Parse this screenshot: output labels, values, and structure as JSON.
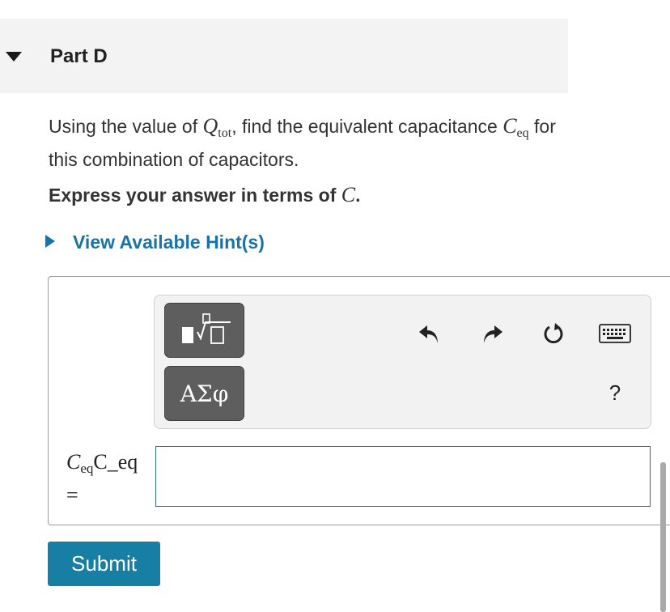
{
  "part": {
    "title": "Part D",
    "expanded": true
  },
  "question": {
    "text_1": "Using the value of",
    "q_symbol": "Q",
    "q_sub": "tot",
    "text_2": ", find the equivalent capacitance",
    "c_symbol": "C",
    "c_sub": "eq",
    "text_3": "for this combination of capacitors."
  },
  "instruction": {
    "text": "Express your answer in terms of",
    "var": "C",
    "period": "."
  },
  "hint": {
    "label": "View Available Hint(s)"
  },
  "toolbar": {
    "greek_label": "ΑΣφ",
    "help_label": "?",
    "icons": [
      "templates-icon",
      "undo-icon",
      "redo-icon",
      "reset-icon",
      "keyboard-icon",
      "help-icon"
    ]
  },
  "answer": {
    "label_var": "C",
    "label_sub": "eq",
    "label_alt": "C_eq",
    "equals": "=",
    "value": ""
  },
  "submit": {
    "label": "Submit"
  },
  "colors": {
    "accent": "#1a73a8",
    "submit_bg": "#177fa3",
    "toolbar_button": "#5e5e5e",
    "header_bg": "#f3f3f3"
  }
}
